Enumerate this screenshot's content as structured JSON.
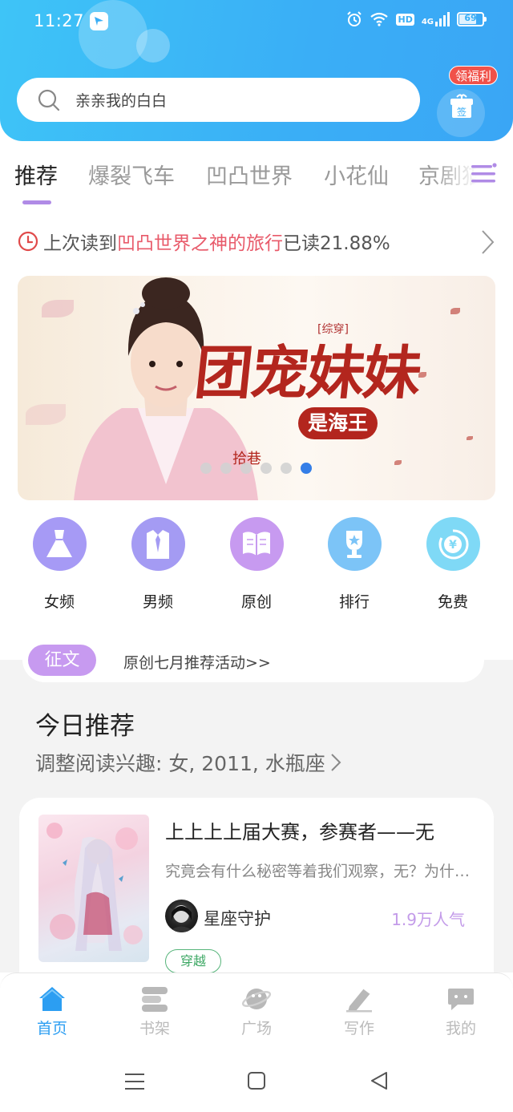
{
  "status_bar": {
    "time": "11:27",
    "network_badge": "HD",
    "signal_label": "4G",
    "battery": "69"
  },
  "header": {
    "search_placeholder": "亲亲我的白白",
    "welfare_label": "领福利",
    "sign_label": "签",
    "accent_color": "#3aaef6"
  },
  "tabs": [
    {
      "label": "推荐",
      "active": true
    },
    {
      "label": "爆裂飞车",
      "active": false
    },
    {
      "label": "凹凸世界",
      "active": false
    },
    {
      "label": "小花仙",
      "active": false
    },
    {
      "label": "京剧猫",
      "active": false
    }
  ],
  "last_read": {
    "prefix": "上次读到",
    "book": "凹凸世界之神的旅行",
    "suffix": "已读21.88%"
  },
  "banner": {
    "tag": "[综穿]",
    "title": "团宠妹妹",
    "subtitle": "是海王",
    "author": "拾巷",
    "slide_count": 6,
    "active_slide": 6
  },
  "categories": [
    {
      "label": "女频",
      "icon": "dress-icon",
      "color": "#a69af5"
    },
    {
      "label": "男频",
      "icon": "shirt-icon",
      "color": "#a49bf3"
    },
    {
      "label": "原创",
      "icon": "book-icon",
      "color": "#c79af0"
    },
    {
      "label": "排行",
      "icon": "trophy-icon",
      "color": "#7cc4f7"
    },
    {
      "label": "免费",
      "icon": "yuan-coin-icon",
      "color": "#7fd9f6"
    }
  ],
  "essay": {
    "badge": "征文",
    "text": "原创七月推荐活动>>"
  },
  "recommend": {
    "title": "今日推荐",
    "subtitle": "调整阅读兴趣: 女, 2011, 水瓶座",
    "book": {
      "title": "上上上上届大赛，参赛者——无",
      "description": "究竟会有什么秘密等着我们观察，无？为什么会有这么多秘密",
      "author": "星座守护",
      "popularity": "1.9万人气",
      "genre": "穿越"
    }
  },
  "bottom_nav": [
    {
      "label": "首页",
      "icon": "home-icon",
      "active": true
    },
    {
      "label": "书架",
      "icon": "bookshelf-icon",
      "active": false
    },
    {
      "label": "广场",
      "icon": "planet-icon",
      "active": false
    },
    {
      "label": "写作",
      "icon": "pen-icon",
      "active": false
    },
    {
      "label": "我的",
      "icon": "chat-bubble-icon",
      "active": false
    }
  ]
}
